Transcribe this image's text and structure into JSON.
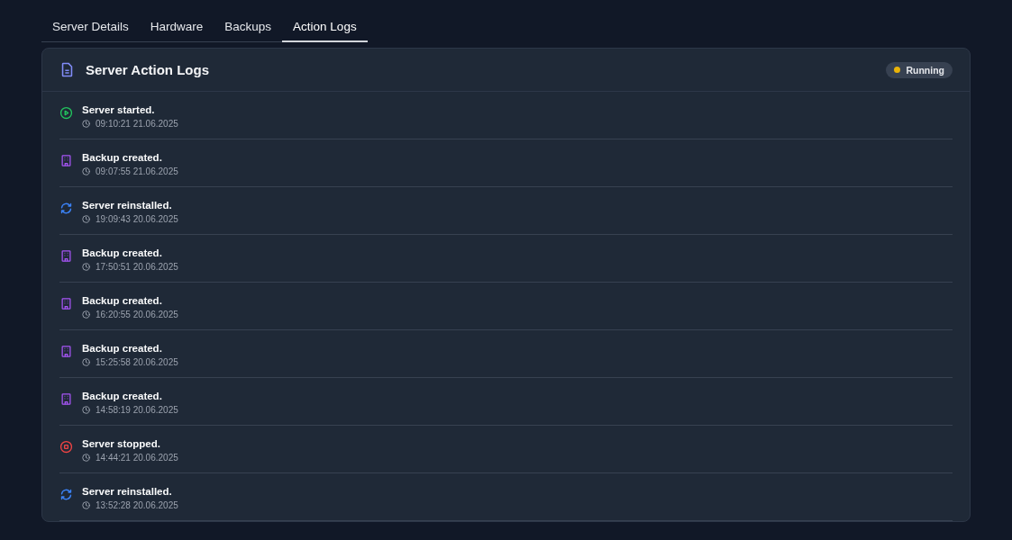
{
  "tabs": [
    {
      "label": "Server Details",
      "selected": false
    },
    {
      "label": "Hardware",
      "selected": false
    },
    {
      "label": "Backups",
      "selected": false
    },
    {
      "label": "Action Logs",
      "selected": true
    }
  ],
  "card": {
    "title": "Server Action Logs",
    "status": {
      "label": "Running",
      "color": "#eab308"
    }
  },
  "logs": [
    {
      "kind": "start",
      "message": "Server started.",
      "time": "09:10:21 21.06.2025"
    },
    {
      "kind": "backup",
      "message": "Backup created.",
      "time": "09:07:55 21.06.2025"
    },
    {
      "kind": "reinstall",
      "message": "Server reinstalled.",
      "time": "19:09:43 20.06.2025"
    },
    {
      "kind": "backup",
      "message": "Backup created.",
      "time": "17:50:51 20.06.2025"
    },
    {
      "kind": "backup",
      "message": "Backup created.",
      "time": "16:20:55 20.06.2025"
    },
    {
      "kind": "backup",
      "message": "Backup created.",
      "time": "15:25:58 20.06.2025"
    },
    {
      "kind": "backup",
      "message": "Backup created.",
      "time": "14:58:19 20.06.2025"
    },
    {
      "kind": "stop",
      "message": "Server stopped.",
      "time": "14:44:21 20.06.2025"
    },
    {
      "kind": "reinstall",
      "message": "Server reinstalled.",
      "time": "13:52:28 20.06.2025"
    }
  ]
}
